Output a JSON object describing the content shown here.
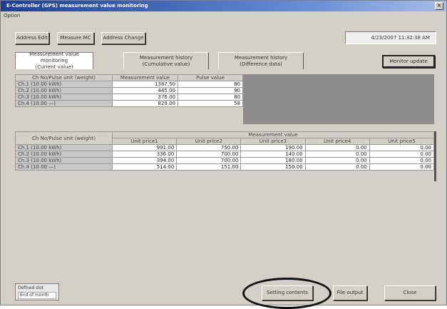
{
  "window": {
    "title": "E-Controller (GPS) measurement value monitoring",
    "close": "×"
  },
  "menu": {
    "option": "Option"
  },
  "toolbar": {
    "address_edit": "Address Edit",
    "measure_mc": "Measure MC",
    "address_change": "Address Change",
    "datetime": "4/23/2007 11:32:38 AM"
  },
  "tabs": [
    {
      "label1": "Measurement value monitoring",
      "label2": "(Current value)"
    },
    {
      "label1": "Measurement history",
      "label2": "(Cumulative value)"
    },
    {
      "label1": "Measurement history",
      "label2": "(Difference data)"
    }
  ],
  "monitor_update": "Monitor update",
  "table1": {
    "headers": [
      "Ch No/Pulse unit (weight)",
      "Measurement value",
      "Pulse value"
    ],
    "rows": [
      {
        "ch": "Ch.1 (10.00 kWh)",
        "meas": "1387.50",
        "pulse": "80"
      },
      {
        "ch": "Ch.2 (10.00 kWh)",
        "meas": "445.00",
        "pulse": "90"
      },
      {
        "ch": "Ch.3 (10.00 kWh)",
        "meas": "376.00",
        "pulse": "80"
      },
      {
        "ch": "Ch.4 (10.00 —)",
        "meas": "829.00",
        "pulse": "58"
      }
    ]
  },
  "table2": {
    "header_ch": "Ch No/Pulse unit (weight)",
    "header_group": "Measurement value",
    "unit_headers": [
      "Unit price1",
      "Unit price2",
      "Unit price3",
      "Unit price4",
      "Unit price5"
    ],
    "rows": [
      {
        "ch": "Ch.1 (10.00 kWh)",
        "v": [
          "991.00",
          "750.00",
          "190.00",
          "0.00",
          "0.00"
        ]
      },
      {
        "ch": "Ch.2 (10.00 kWh)",
        "v": [
          "336.00",
          "700.00",
          "140.00",
          "0.00",
          "0.00"
        ]
      },
      {
        "ch": "Ch.3 (10.00 kWh)",
        "v": [
          "394.00",
          "700.00",
          "180.00",
          "0.00",
          "0.00"
        ]
      },
      {
        "ch": "Ch.4 (10.00 —)",
        "v": [
          "514.00",
          "151.00",
          "150.00",
          "0.00",
          "0.00"
        ]
      }
    ]
  },
  "legend": {
    "title": "Defined slot",
    "value": "End of month"
  },
  "bottom_buttons": {
    "setting_contents": "Setting contents",
    "file_output": "File output",
    "close": "Close"
  }
}
